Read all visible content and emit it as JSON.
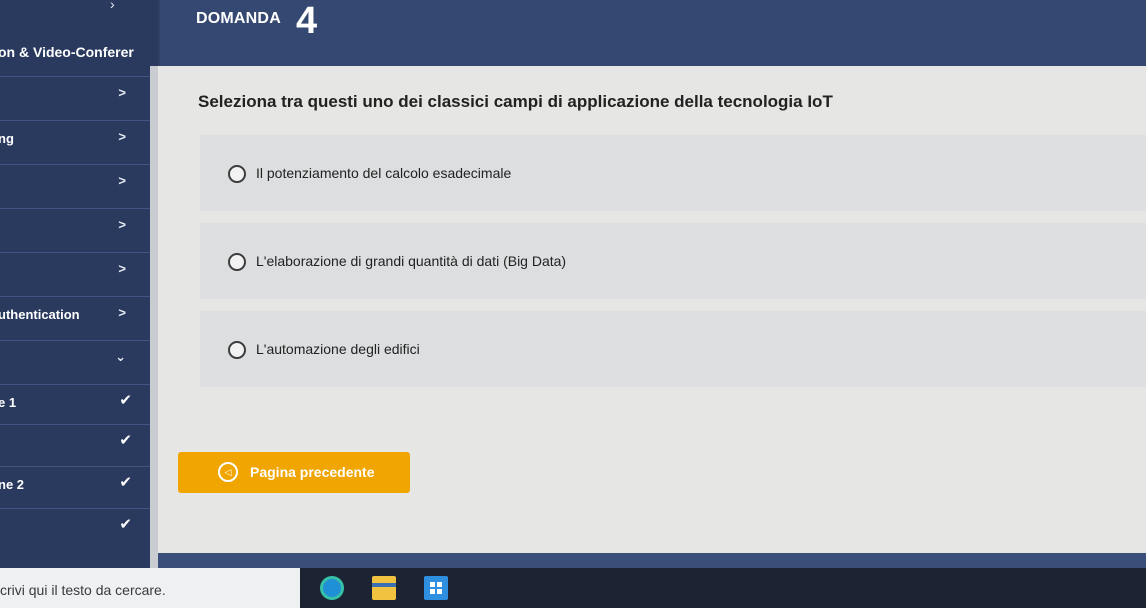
{
  "header": {
    "domanda_label": "DOMANDA",
    "domanda_number": "4"
  },
  "sidebar": {
    "title": "on & Video-Conferer",
    "items": [
      {
        "label": "",
        "marker": ">"
      },
      {
        "label": "ng",
        "marker": ">"
      },
      {
        "label": "",
        "marker": ">"
      },
      {
        "label": "",
        "marker": ">"
      },
      {
        "label": "",
        "marker": ">"
      },
      {
        "label": "uthentication",
        "marker": ">"
      },
      {
        "label": "",
        "marker": "⌄"
      },
      {
        "label": "e 1",
        "marker": "✔"
      },
      {
        "label": "",
        "marker": "✔"
      },
      {
        "label": "ne 2",
        "marker": "✔"
      },
      {
        "label": "",
        "marker": "✔"
      }
    ]
  },
  "question": {
    "text": "Seleziona tra questi uno dei classici campi di applicazione della tecnologia IoT",
    "options": [
      {
        "label": "Il potenziamento del calcolo esadecimale"
      },
      {
        "label": "L'elaborazione di grandi quantità di dati (Big Data)"
      },
      {
        "label": "L'automazione degli edifici"
      }
    ]
  },
  "nav": {
    "prev_label": "Pagina precedente",
    "prev_icon": "◁"
  },
  "taskbar": {
    "search_placeholder": "crivi qui il testo da cercare.",
    "icons": [
      "edge-icon",
      "file-explorer-icon",
      "store-icon"
    ]
  },
  "colors": {
    "header_bg": "#354872",
    "sidebar_bg": "#2a3a5e",
    "button_bg": "#f0a500",
    "content_bg": "#e6e6e4"
  }
}
